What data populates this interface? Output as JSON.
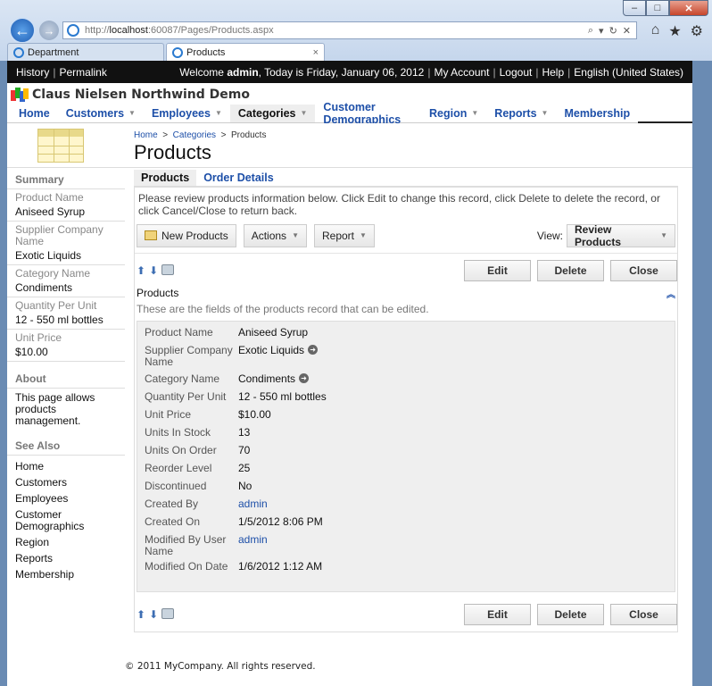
{
  "browser": {
    "url_prefix": "http://",
    "url_host": "localhost",
    "url_rest": ":60087/Pages/Products.aspx",
    "tabs": [
      {
        "label": "Department"
      },
      {
        "label": "Products",
        "close": "×"
      }
    ]
  },
  "topbar": {
    "history": "History",
    "permalink": "Permalink",
    "welcome_prefix": "Welcome ",
    "user": "admin",
    "welcome_suffix": ", Today is Friday, January 06, 2012",
    "my_account": "My Account",
    "logout": "Logout",
    "help": "Help",
    "language": "English (United States)"
  },
  "brand": {
    "title": "Claus Nielsen Northwind Demo"
  },
  "menu": [
    {
      "label": "Home"
    },
    {
      "label": "Customers",
      "arrow": "▼"
    },
    {
      "label": "Employees",
      "arrow": "▼"
    },
    {
      "label": "Categories",
      "arrow": "▼"
    },
    {
      "label": "Customer Demographics"
    },
    {
      "label": "Region",
      "arrow": "▼"
    },
    {
      "label": "Reports",
      "arrow": "▼"
    },
    {
      "label": "Membership"
    }
  ],
  "header": {
    "breadcrumb": [
      "Home",
      "Categories",
      "Products"
    ],
    "breadcrumb_sep": ">",
    "title": "Products"
  },
  "sidebar": {
    "summary_title": "Summary",
    "summary": [
      {
        "label": "Product Name",
        "value": "Aniseed Syrup"
      },
      {
        "label": "Supplier Company Name",
        "value": "Exotic Liquids"
      },
      {
        "label": "Category Name",
        "value": "Condiments"
      },
      {
        "label": "Quantity Per Unit",
        "value": "12 - 550 ml bottles"
      },
      {
        "label": "Unit Price",
        "value": "$10.00"
      }
    ],
    "about_title": "About",
    "about_text": "This page allows products management.",
    "see_also_title": "See Also",
    "see_also": [
      "Home",
      "Customers",
      "Employees",
      "Customer Demographics",
      "Region",
      "Reports",
      "Membership"
    ]
  },
  "main": {
    "tabs": [
      {
        "label": "Products"
      },
      {
        "label": "Order Details"
      }
    ],
    "instructions": "Please review products information below. Click Edit to change this record, click Delete to delete the record, or click Cancel/Close to return back.",
    "toolbar": {
      "new": "New Products",
      "actions": "Actions",
      "report": "Report",
      "view_label": "View:",
      "view_value": "Review Products"
    },
    "buttons": {
      "edit": "Edit",
      "delete": "Delete",
      "close": "Close"
    },
    "section_title": "Products",
    "section_desc": "These are the fields of the products record that can be edited.",
    "fields": [
      {
        "label": "Product Name",
        "value": "Aniseed Syrup"
      },
      {
        "label": "Supplier Company Name",
        "value": "Exotic Liquids"
      },
      {
        "label": "Category Name",
        "value": "Condiments"
      },
      {
        "label": "Quantity Per Unit",
        "value": "12 - 550 ml bottles"
      },
      {
        "label": "Unit Price",
        "value": "$10.00"
      },
      {
        "label": "Units In Stock",
        "value": "13"
      },
      {
        "label": "Units On Order",
        "value": "70"
      },
      {
        "label": "Reorder Level",
        "value": "25"
      },
      {
        "label": "Discontinued",
        "value": "No"
      },
      {
        "label": "Created By",
        "value": "admin"
      },
      {
        "label": "Created On",
        "value": "1/5/2012 8:06 PM"
      },
      {
        "label": "Modified By User Name",
        "value": "admin"
      },
      {
        "label": "Modified On Date",
        "value": "1/6/2012 1:12 AM"
      }
    ]
  },
  "footer": {
    "text": "© 2011 MyCompany. All rights reserved."
  },
  "colors": {
    "link": "#1d4fa8",
    "topbar": "#111111",
    "panel_bg": "#efefef"
  }
}
